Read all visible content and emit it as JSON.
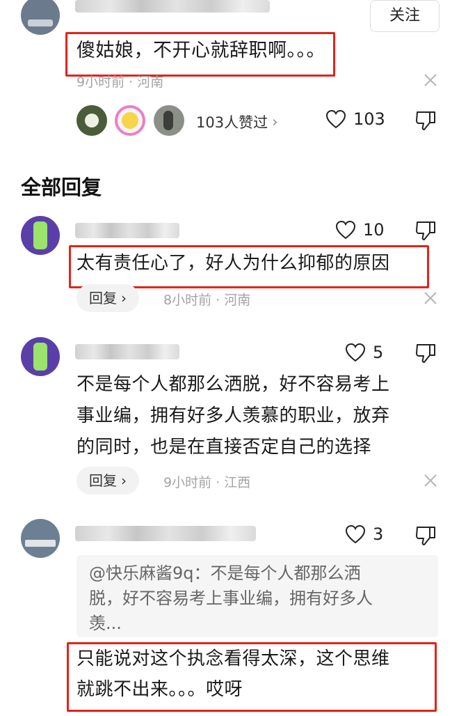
{
  "top_comment": {
    "follow_label": "关注",
    "text": "傻姑娘，不开心就辞职啊。。。",
    "meta": "9小时前 · 河南",
    "likers_label": "103人赞过",
    "like_count": "103"
  },
  "section_title": "全部回复",
  "replies": [
    {
      "text": "太有责任心了，好人为什么抑郁的原因",
      "reply_label": "回复",
      "meta": "8小时前 · 河南",
      "like_count": "10"
    },
    {
      "text_lines": [
        "不是每个人都那么洒脱，好不容易考上",
        "事业编，拥有好多人羡慕的职业，放弃",
        "的同时，也是在直接否定自己的选择"
      ],
      "reply_label": "回复",
      "meta": "9小时前 · 江西",
      "like_count": "5"
    },
    {
      "quote_lines": [
        "@快乐麻酱9q：不是每个人都那么洒",
        "脱，好不容易考上事业编，拥有好多人",
        "羡..."
      ],
      "text_lines": [
        "只能说对这个执念看得太深，这个思维",
        "就跳不出来。。。哎呀"
      ],
      "like_count": "3"
    }
  ],
  "colors": {
    "highlight_box": "#e2231a",
    "meta_text": "#a3a3a3",
    "pill_bg": "#f2f2f2"
  }
}
